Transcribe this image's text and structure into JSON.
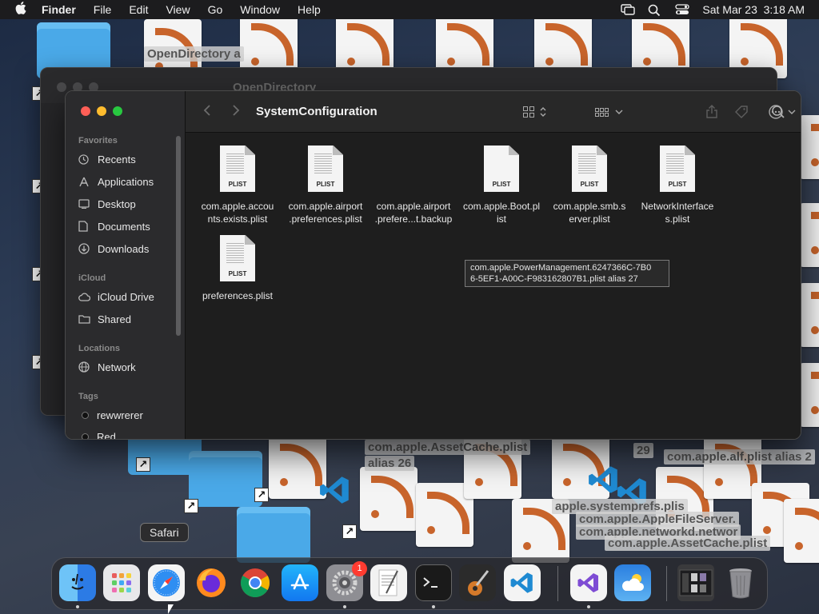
{
  "menubar": {
    "app_name": "Finder",
    "menus": [
      "File",
      "Edit",
      "View",
      "Go",
      "Window",
      "Help"
    ],
    "datetime": "Sat Mar 23  3:18 AM"
  },
  "desktop": {
    "labels": [
      "OpenDirectory a",
      "com.apple.AssetCache.plist",
      "alias 26",
      "com.apple.alf.plist alias 2",
      "29",
      "apple.systemprefs.plis",
      "com.apple.AppleFileServer.",
      "com.apple.networkd.networ",
      "com.apple.AssetCache.plist"
    ]
  },
  "back_window": {
    "title": "OpenDirectory"
  },
  "finder": {
    "title": "SystemConfiguration",
    "sidebar": {
      "favorites_header": "Favorites",
      "favorites": [
        {
          "label": "Recents",
          "icon": "clock-icon"
        },
        {
          "label": "Applications",
          "icon": "applications-icon"
        },
        {
          "label": "Desktop",
          "icon": "desktop-icon"
        },
        {
          "label": "Documents",
          "icon": "document-icon"
        },
        {
          "label": "Downloads",
          "icon": "downloads-icon"
        }
      ],
      "icloud_header": "iCloud",
      "icloud": [
        {
          "label": "iCloud Drive",
          "icon": "cloud-icon"
        },
        {
          "label": "Shared",
          "icon": "shared-folder-icon"
        }
      ],
      "locations_header": "Locations",
      "locations": [
        {
          "label": "Network",
          "icon": "globe-icon"
        }
      ],
      "tags_header": "Tags",
      "tags": [
        {
          "label": "rewwrerer"
        },
        {
          "label": "Red"
        }
      ]
    },
    "files": [
      {
        "line1": "com.apple.accou",
        "line2": "nts.exists.plist",
        "ext": "PLIST"
      },
      {
        "line1": "com.apple.airport",
        "line2": ".preferences.plist",
        "ext": "PLIST"
      },
      {
        "line1": "com.apple.airport",
        "line2": ".prefere...t.backup",
        "ext": ""
      },
      {
        "line1": "com.apple.Boot.pl",
        "line2": "ist",
        "ext": "PLIST"
      },
      {
        "line1": "com.apple.smb.s",
        "line2": "erver.plist",
        "ext": "PLIST"
      },
      {
        "line1": "NetworkInterface",
        "line2": "s.plist",
        "ext": "PLIST"
      },
      {
        "line1": "preferences.plist",
        "line2": "",
        "ext": "PLIST"
      }
    ],
    "tooltip": {
      "line1": "com.apple.PowerManagement.6247366C-7B0",
      "line2": "6-5EF1-A00C-F983162807B1.plist alias 27"
    }
  },
  "dock": {
    "tooltip": "Safari",
    "badge": "1",
    "apps": [
      "Finder",
      "Launchpad",
      "Safari",
      "Firefox",
      "Chrome",
      "App Store",
      "System Settings",
      "TextEdit",
      "Terminal",
      "GarageBand",
      "Visual Studio Code",
      "Visual Studio",
      "Weather",
      "Window Preview",
      "Trash"
    ]
  }
}
